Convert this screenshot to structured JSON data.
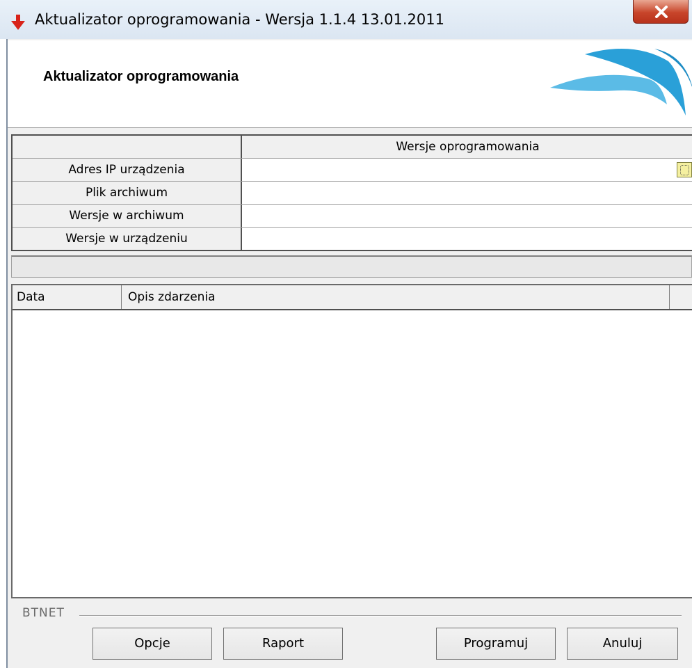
{
  "window": {
    "title": "Aktualizator oprogramowania - Wersja  1.1.4  13.01.2011",
    "app_icon": "red-down-arrow-icon",
    "close_icon": "close-icon"
  },
  "header": {
    "title": "Aktualizator oprogramowania"
  },
  "info_grid": {
    "column_header": "Wersje oprogramowania",
    "rows": [
      {
        "label": "Adres IP urządzenia",
        "value": ""
      },
      {
        "label": "Plik archiwum",
        "value": ""
      },
      {
        "label": "Wersje w archiwum",
        "value": ""
      },
      {
        "label": "Wersje w urządzeniu",
        "value": ""
      }
    ]
  },
  "progress": {
    "value": 0
  },
  "event_list": {
    "columns": [
      "Data",
      "Opis zdarzenia",
      ""
    ],
    "rows": []
  },
  "footer": {
    "group_label": "BTNET",
    "buttons": {
      "options": "Opcje",
      "report": "Raport",
      "program": "Programuj",
      "cancel": "Anuluj"
    }
  },
  "colors": {
    "title_bar": "#dbe6f2",
    "close_button": "#c8452a",
    "swoosh": "#2aa0d8",
    "browse_button": "#f5f0a0"
  }
}
